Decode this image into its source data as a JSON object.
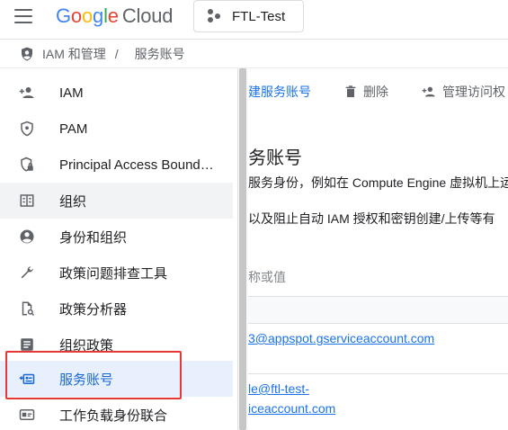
{
  "header": {
    "logo": {
      "g1": "G",
      "o1": "o",
      "o2": "o",
      "g2": "g",
      "l": "l",
      "e": "e",
      "cloud": "Cloud"
    },
    "project": "FTL-Test"
  },
  "breadcrumb": {
    "section": "IAM 和管理",
    "separator": "/",
    "page": "服务账号"
  },
  "sidebar": {
    "items": [
      {
        "label": "IAM",
        "icon": "person-add-icon"
      },
      {
        "label": "PAM",
        "icon": "shield-icon"
      },
      {
        "label": "Principal Access Bound…",
        "icon": "shield-lock-icon"
      },
      {
        "label": "组织",
        "icon": "building-icon"
      },
      {
        "label": "身份和组织",
        "icon": "account-circle-icon"
      },
      {
        "label": "政策问题排查工具",
        "icon": "wrench-icon"
      },
      {
        "label": "政策分析器",
        "icon": "document-search-icon"
      },
      {
        "label": "组织政策",
        "icon": "list-document-icon"
      },
      {
        "label": "服务账号",
        "icon": "service-account-icon"
      },
      {
        "label": "工作负载身份联合",
        "icon": "id-card-icon"
      }
    ]
  },
  "toolbar": {
    "create": "建服务账号",
    "delete": "删除",
    "manage": "管理访问权"
  },
  "main": {
    "title": "务账号",
    "desc1": "服务身份，例如在 Compute Engine 虚拟机上运",
    "desc2": "以及阻止自动 IAM 授权和密钥创建/上传等有",
    "filter_placeholder": "称或值",
    "row1_email": "3@appspot.gserviceaccount.com",
    "row2_email_line1": "le@ftl-test-",
    "row2_email_line2": "iceaccount.com"
  },
  "colors": {
    "accent": "#1a73e8",
    "selected_bg": "#e8f0fe",
    "highlight": "#e53935"
  }
}
